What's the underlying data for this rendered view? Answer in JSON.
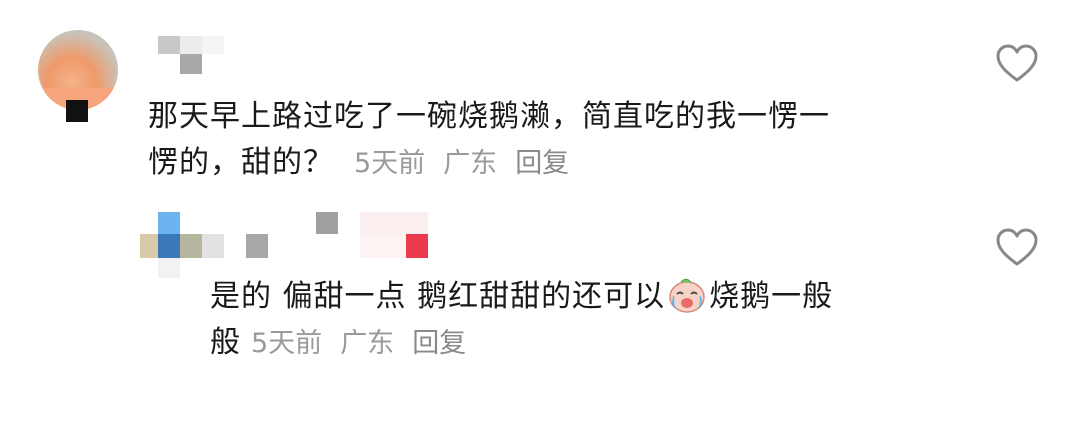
{
  "comments": [
    {
      "text": "那天早上路过吃了一碗烧鹅濑，简直吃的我一愣一",
      "text_line2": "愣的，甜的？",
      "time": "5天前",
      "location": "广东",
      "reply_label": "回复",
      "like_icon": "heart-icon"
    },
    {
      "text_part1": "是的 偏甜一点  鹅红甜甜的还可以",
      "emoji": "crying-laughing-emoji",
      "text_part2": "烧鹅一般",
      "text_line2": "般",
      "time": "5天前",
      "location": "广东",
      "reply_label": "回复",
      "like_icon": "heart-icon"
    }
  ],
  "colors": {
    "text": "#1a1a1a",
    "meta": "#9a9a9a",
    "icon": "#888888"
  }
}
